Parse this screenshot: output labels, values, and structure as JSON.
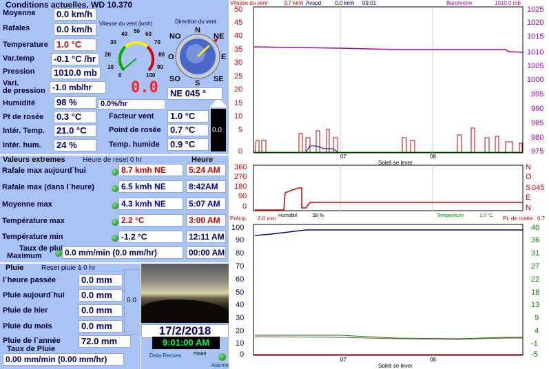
{
  "current": {
    "title": "Conditions actuelles, WD 10.370",
    "rows": [
      {
        "label": "Moyenne",
        "value": "0.0 km/h"
      },
      {
        "label": "Rafales",
        "value": "0.0 km/h"
      },
      {
        "label": "Temperature",
        "value": "1.0 °C"
      },
      {
        "label": "Var.temp",
        "value": "-0.1 °C /hr"
      },
      {
        "label": "Pression",
        "value": "1010.0 mb"
      },
      {
        "label": "Vari.",
        "value": "-1.0 mb/hr"
      }
    ],
    "vari_sub": "de pression",
    "humidity": {
      "label": "Humidité",
      "value": "98 %",
      "rate": "0.0%/hr"
    },
    "dew": {
      "label": "Pt de rosée",
      "value": "0.3 °C"
    },
    "indoor_temp": {
      "label": "Intér. Temp.",
      "value": "21.0 °C"
    },
    "indoor_hum": {
      "label": "Intér. hum.",
      "value": "24 %"
    },
    "wind_factor": {
      "label": "Facteur vent",
      "value": "1.0 °C"
    },
    "dew_point2": {
      "label": "Point de rosée",
      "value": "0.7 °C"
    },
    "humid_temp": {
      "label": "Temp. humide",
      "value": "0.9 °C"
    },
    "side_value": "0.0"
  },
  "gauge": {
    "title": "Vitesse du vent (kmh)",
    "ticks": [
      "0",
      "10",
      "20",
      "30",
      "40",
      "50",
      "60",
      "70",
      "80",
      "90",
      "100"
    ],
    "digital": "0.0"
  },
  "compass": {
    "title": "Direction du vent",
    "labels": {
      "n": "N",
      "ne": "NE",
      "e": "E",
      "se": "SE",
      "s": "S",
      "so": "SO",
      "o": "O",
      "no": "NO"
    },
    "reading": "NE  045 °"
  },
  "extremes": {
    "title": "Valeurs extremes",
    "reset": "Heure de reset 0 hr",
    "time_header": "Heure",
    "rows": [
      {
        "label": "Rafale max aujourd`hui",
        "value": "8.7 kmh  NE",
        "time": "5:24 AM",
        "red": true
      },
      {
        "label": "Rafale max (dans l`heure)",
        "value": "6.5 kmh  NE",
        "time": "8:42AM",
        "red": false
      },
      {
        "label": "Moyenne max",
        "value": "4.3 kmh  NE",
        "time": "5:07 AM",
        "red": false
      },
      {
        "label": "Température max",
        "value": "2.2 °C",
        "time": "3:00 AM",
        "red": true
      },
      {
        "label": "Température min",
        "value": "-1.2 °C",
        "time": "12:11 AM",
        "red": false
      }
    ],
    "rain_rate_label": "Taux de pluie",
    "rain_rate_sub": "Maximum",
    "rain_rate_value": "0.0 mm/min (0.0 mm/hr)",
    "rain_rate_time": "00:00 AM"
  },
  "rain": {
    "title": "Pluie",
    "reset": "Reset pluie à 0 hr",
    "rows": [
      {
        "label": "l`heure passée",
        "value": "0.0 mm"
      },
      {
        "label": "Pluie aujourd`hui",
        "value": "0.0 mm"
      },
      {
        "label": "Pluie de hier",
        "value": "0.0 mm"
      },
      {
        "label": "Pluie du mois",
        "value": "0.0 mm"
      },
      {
        "label": "Pluie de l`année",
        "value": "72.0 mm"
      }
    ],
    "rate_label": "Taux de Pluie",
    "rate_value": "0.00 mm/min (0.00 mm/hr)",
    "side_value": "0.0"
  },
  "clock": {
    "date": "17/2/2018",
    "time": "9:01:00 AM",
    "data_label": "Data Recues",
    "data_count": "75686",
    "alarm": "Alarme"
  },
  "charts": {
    "wind": {
      "left_label": "Vitesse du vent",
      "speed": "3.7 kmh",
      "avspd": "Avspd",
      "avspd_value": "0.0 kmh",
      "time": "09:01",
      "right_label": "Barometre",
      "right_value": "1010.0 mb",
      "left_ticks": [
        "50",
        "45",
        "40",
        "35",
        "30",
        "25",
        "20",
        "15",
        "10",
        "5",
        "0"
      ],
      "right_ticks": [
        "1025",
        "1020",
        "1015",
        "1010",
        "1005",
        "1000",
        "995",
        "990",
        "985",
        "980",
        "975"
      ],
      "x_labels": [
        "07",
        "08"
      ],
      "footer": "Soleil se lever"
    },
    "direction": {
      "left_ticks": [
        "360",
        "270",
        "180",
        "90",
        "0"
      ],
      "right_ticks": [
        "N",
        "O",
        "S",
        "E",
        "N"
      ],
      "right_value": "045",
      "footer_left": "Humidité",
      "footer_left_val": "98 %",
      "footer_right": "Temperature",
      "footer_right_val": "1.0 °C"
    },
    "temp": {
      "left_label": "Précip.",
      "left_value": "0.0 mm",
      "right_label": "Pt. de rosée",
      "right_value": "0.7",
      "left_ticks": [
        "100",
        "90",
        "80",
        "70",
        "60",
        "50",
        "40",
        "30",
        "20",
        "10",
        "0"
      ],
      "right_ticks": [
        "40",
        "36",
        "31",
        "27",
        "22",
        "18",
        "13",
        "9",
        "4",
        "-1",
        "-5"
      ],
      "x_labels": [
        "07",
        "08"
      ],
      "footer": "Soleil se lever"
    }
  }
}
